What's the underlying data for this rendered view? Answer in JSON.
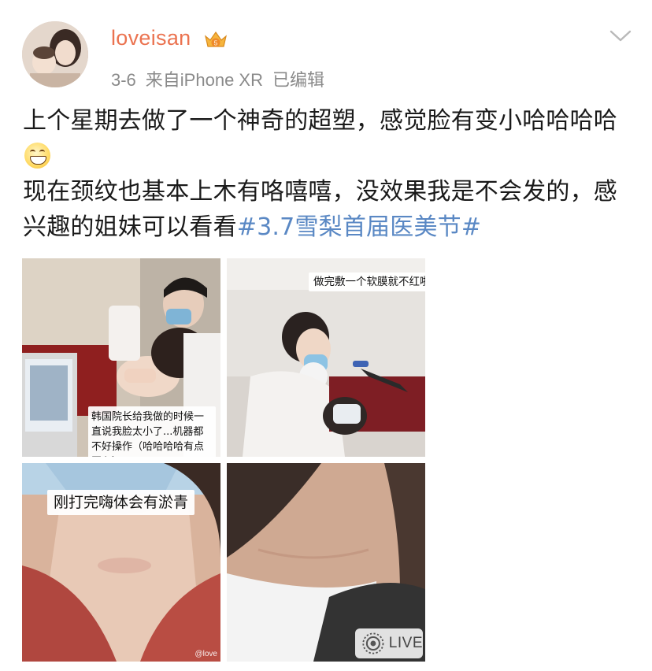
{
  "post": {
    "author": "loveisan",
    "crown_badge_icon": "vip-crown-icon",
    "date": "3-6",
    "source": "来自iPhone XR",
    "edited": "已编辑",
    "menu_icon": "chevron-down-icon",
    "text_line1": "上个星期去做了一个神奇的超塑，感觉脸有变小哈哈哈哈",
    "text_line1_emoji": "grinning-emoji",
    "text_line2_a": "现在颈纹也基本上木有咯嘻嘻，没效果我是不会发的，感兴趣的姐妹可以看看",
    "hashtag": "#3.7雪梨首届医美节#"
  },
  "images": [
    {
      "caption": "韩国院长给我做的时候一直说我脸太小了...机器都不好操作（哈哈哈哈有点开心）",
      "watermark": ""
    },
    {
      "caption": "做完敷一个软膜就不红啦",
      "watermark": ""
    },
    {
      "caption": "刚打完嗨体会有淤青",
      "watermark": "@love"
    },
    {
      "caption": "",
      "live_label": "LIVE",
      "live_icon": "live-photo-icon"
    }
  ],
  "colors": {
    "username": "#eb7350",
    "hashtag": "#5a88c4",
    "meta": "#8a8a8a"
  }
}
